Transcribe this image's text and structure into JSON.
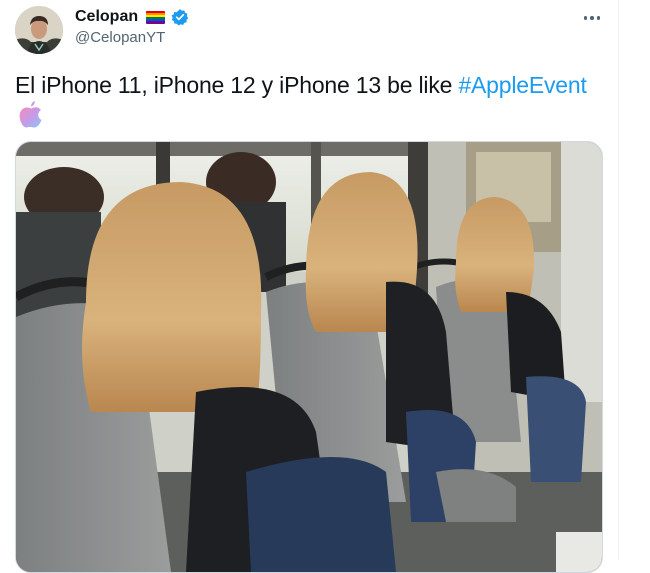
{
  "tweet": {
    "author": {
      "display_name": "Celopan",
      "handle": "@CelopanYT",
      "flag_icon": "rainbow-flag-icon",
      "verified_icon": "verified-badge-icon"
    },
    "text_plain": "El iPhone 11, iPhone 12 y iPhone 13 be like ",
    "hashtag": "#AppleEvent",
    "emoji": "apple-emoji-icon",
    "media": {
      "type": "photo",
      "description_icon": "photo-bus-passengers"
    },
    "more_icon": "more-dots-icon"
  },
  "colors": {
    "link": "#1d9bf0",
    "secondary_text": "#536471",
    "verified": "#1d9bf0"
  }
}
